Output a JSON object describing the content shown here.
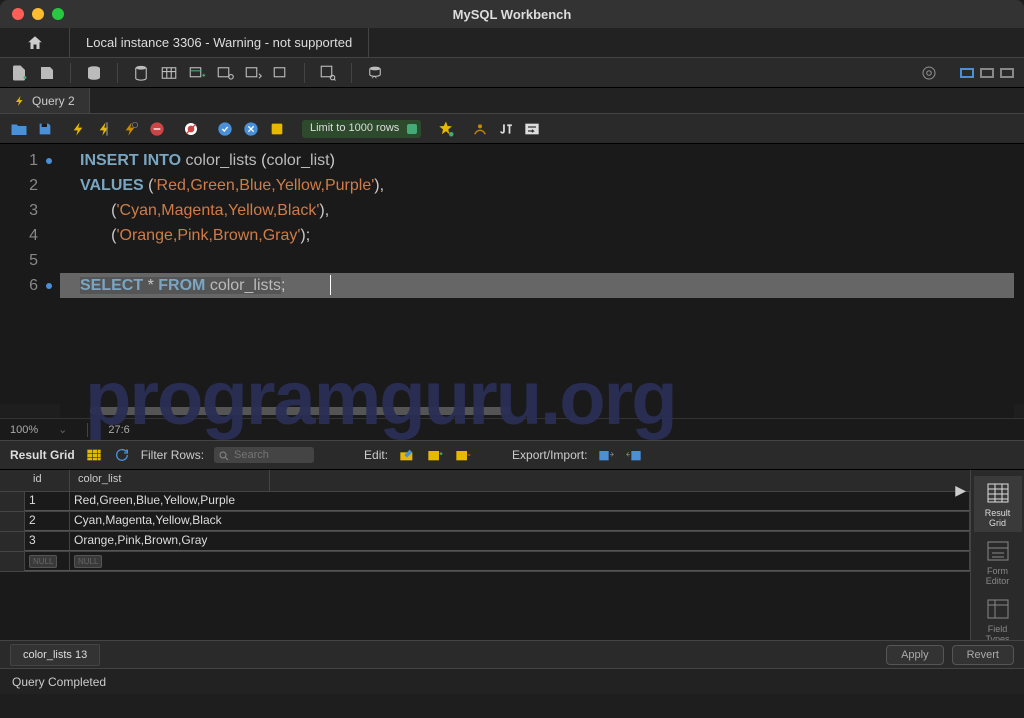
{
  "title": "MySQL Workbench",
  "conn_tab": "Local instance 3306 - Warning - not supported",
  "query_tab": "Query 2",
  "limit_selector": "Limit to 1000 rows",
  "editor": {
    "zoom": "100%",
    "cursor": "27:6",
    "lines": [
      {
        "n": "1",
        "dot": true
      },
      {
        "n": "2",
        "dot": false
      },
      {
        "n": "3",
        "dot": false
      },
      {
        "n": "4",
        "dot": false
      },
      {
        "n": "5",
        "dot": false
      },
      {
        "n": "6",
        "dot": true
      }
    ],
    "code": {
      "l1": {
        "k1": "INSERT",
        "k2": "INTO",
        "t1": "color_lists",
        "p1": "(",
        "t2": "color_list",
        "p2": ")"
      },
      "l2": {
        "k1": "VALUES",
        "p1": "(",
        "s1": "'Red,Green,Blue,Yellow,Purple'",
        "p2": "),"
      },
      "l3": {
        "p1": "(",
        "s1": "'Cyan,Magenta,Yellow,Black'",
        "p2": "),"
      },
      "l4": {
        "p1": "(",
        "s1": "'Orange,Pink,Brown,Gray'",
        "p2": ");"
      },
      "l6": {
        "k1": "SELECT",
        "p1": "*",
        "k2": "FROM",
        "t1": "color_lists",
        "p2": ";"
      }
    }
  },
  "result": {
    "grid_label": "Result Grid",
    "filter_label": "Filter Rows:",
    "search_placeholder": "Search",
    "edit_label": "Edit:",
    "export_label": "Export/Import:",
    "columns": {
      "c1": "id",
      "c2": "color_list"
    },
    "rows": [
      {
        "id": "1",
        "cl": "Red,Green,Blue,Yellow,Purple"
      },
      {
        "id": "2",
        "cl": "Cyan,Magenta,Yellow,Black"
      },
      {
        "id": "3",
        "cl": "Orange,Pink,Brown,Gray"
      }
    ],
    "null_label": "NULL"
  },
  "side": {
    "result_grid": "Result\nGrid",
    "form_editor": "Form\nEditor",
    "field_types": "Field\nTypes"
  },
  "bottom_tab": "color_lists 13",
  "btn_apply": "Apply",
  "btn_revert": "Revert",
  "status": "Query Completed",
  "watermark": "programguru.org"
}
